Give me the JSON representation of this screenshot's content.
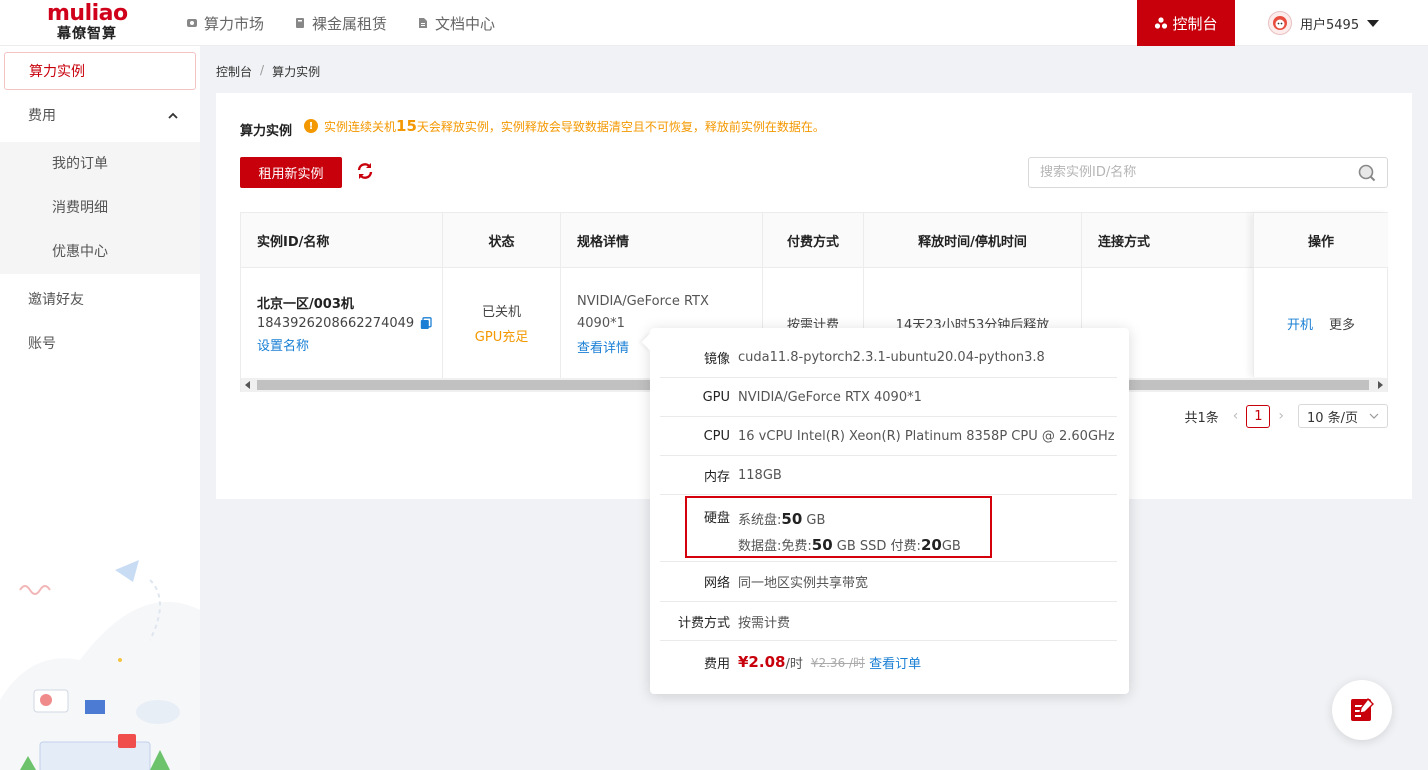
{
  "logo": {
    "text_top": "muliao",
    "text_bottom": "幕僚智算"
  },
  "topnav": [
    {
      "label": "算力市场",
      "icon": "market-icon"
    },
    {
      "label": "裸金属租赁",
      "icon": "server-icon"
    },
    {
      "label": "文档中心",
      "icon": "document-icon"
    }
  ],
  "console_label": "控制台",
  "user_name": "用户5495",
  "sidebar": {
    "active": "算力实例",
    "fees": "费用",
    "sub": [
      "我的订单",
      "消费明细",
      "优惠中心"
    ],
    "invite": "邀请好友",
    "account": "账号"
  },
  "breadcrumb": [
    "控制台",
    "/",
    "算力实例"
  ],
  "section": {
    "title": "算力实例",
    "warn_pre": "实例连续关机",
    "warn_days": "15",
    "warn_post": "天会释放实例，实例释放会导致数据清空且不可恢复，释放前实例在数据在。"
  },
  "rent_button": "租用新实例",
  "search_placeholder": "搜索实例ID/名称",
  "table": {
    "headers": [
      "实例ID/名称",
      "状态",
      "规格详情",
      "付费方式",
      "释放时间/停机时间",
      "连接方式",
      "操作"
    ],
    "row": {
      "name": "北京一区/003机",
      "id": "1843926208662274049",
      "set_name": "设置名称",
      "status": "已关机",
      "gpu_status": "GPU充足",
      "spec_line1": "NVIDIA/GeForce RTX",
      "spec_line2": "4090*1",
      "spec_link": "查看详情",
      "billing": "按需计费",
      "release": "14天23小时53分钟后释放",
      "op_start": "开机",
      "op_more": "更多"
    }
  },
  "pager": {
    "total": "共1条",
    "page": "1",
    "size": "10 条/页"
  },
  "popover": {
    "image_label": "镜像",
    "image": "cuda11.8-pytorch2.3.1-ubuntu20.04-python3.8",
    "gpu_label": "GPU",
    "gpu": "NVIDIA/GeForce RTX 4090*1",
    "cpu_label": "CPU",
    "cpu": "16 vCPU Intel(R) Xeon(R) Platinum 8358P CPU @ 2.60GHz",
    "mem_label": "内存",
    "mem": "118GB",
    "disk_label": "硬盘",
    "sys_pre": "系统盘:",
    "sys_num": "50",
    "sys_unit": "GB",
    "data_pre": "数据盘:免费:",
    "data_num": "50",
    "data_mid": "GB SSD 付费:",
    "data_paid": "20",
    "data_unit": "GB",
    "net_label": "网络",
    "net": "同一地区实例共享带宽",
    "billing_label": "计费方式",
    "billing": "按需计费",
    "fee_label": "费用",
    "price": "¥2.08",
    "per": "/时",
    "old_price": "¥2.36 /时",
    "order_link": "查看订单"
  },
  "colors": {
    "brand": "#c8000b",
    "link": "#1a7fd4",
    "warn": "#f39800"
  }
}
